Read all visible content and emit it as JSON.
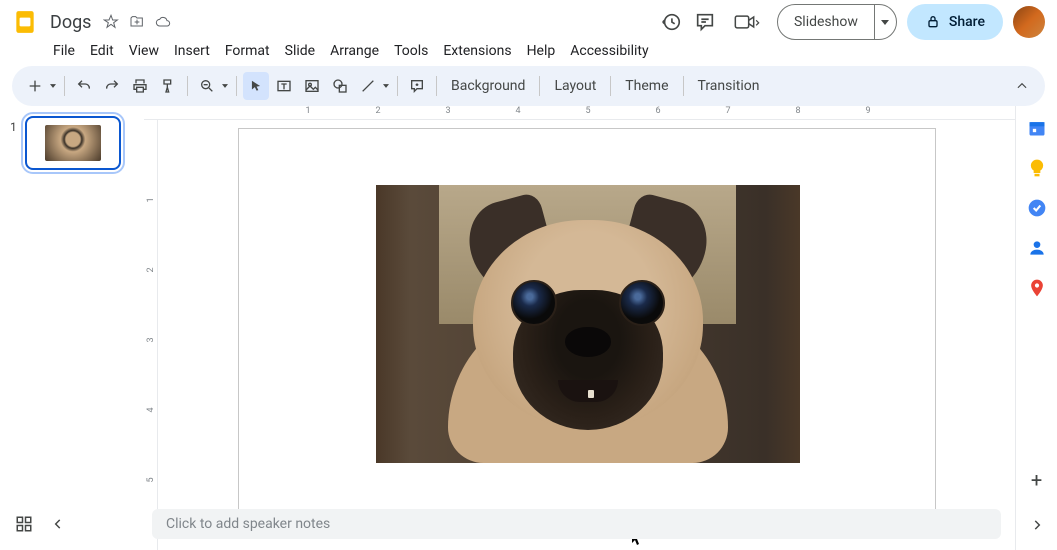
{
  "doc": {
    "title": "Dogs"
  },
  "menu": [
    "File",
    "Edit",
    "View",
    "Insert",
    "Format",
    "Slide",
    "Arrange",
    "Tools",
    "Extensions",
    "Help",
    "Accessibility"
  ],
  "header_buttons": {
    "slideshow": "Slideshow",
    "share": "Share"
  },
  "toolbar_text": {
    "background": "Background",
    "layout": "Layout",
    "theme": "Theme",
    "transition": "Transition"
  },
  "filmstrip": {
    "slides": [
      {
        "num": "1"
      }
    ]
  },
  "ruler_h": [
    "1",
    "2",
    "3",
    "4",
    "5",
    "6",
    "7",
    "8",
    "9"
  ],
  "ruler_v": [
    "1",
    "2",
    "3",
    "4",
    "5"
  ],
  "notes": {
    "placeholder": "Click to add speaker notes"
  },
  "colors": {
    "accent": "#0b57d0",
    "share_bg": "#c2e7ff",
    "toolbar_bg": "#edf2fa"
  }
}
